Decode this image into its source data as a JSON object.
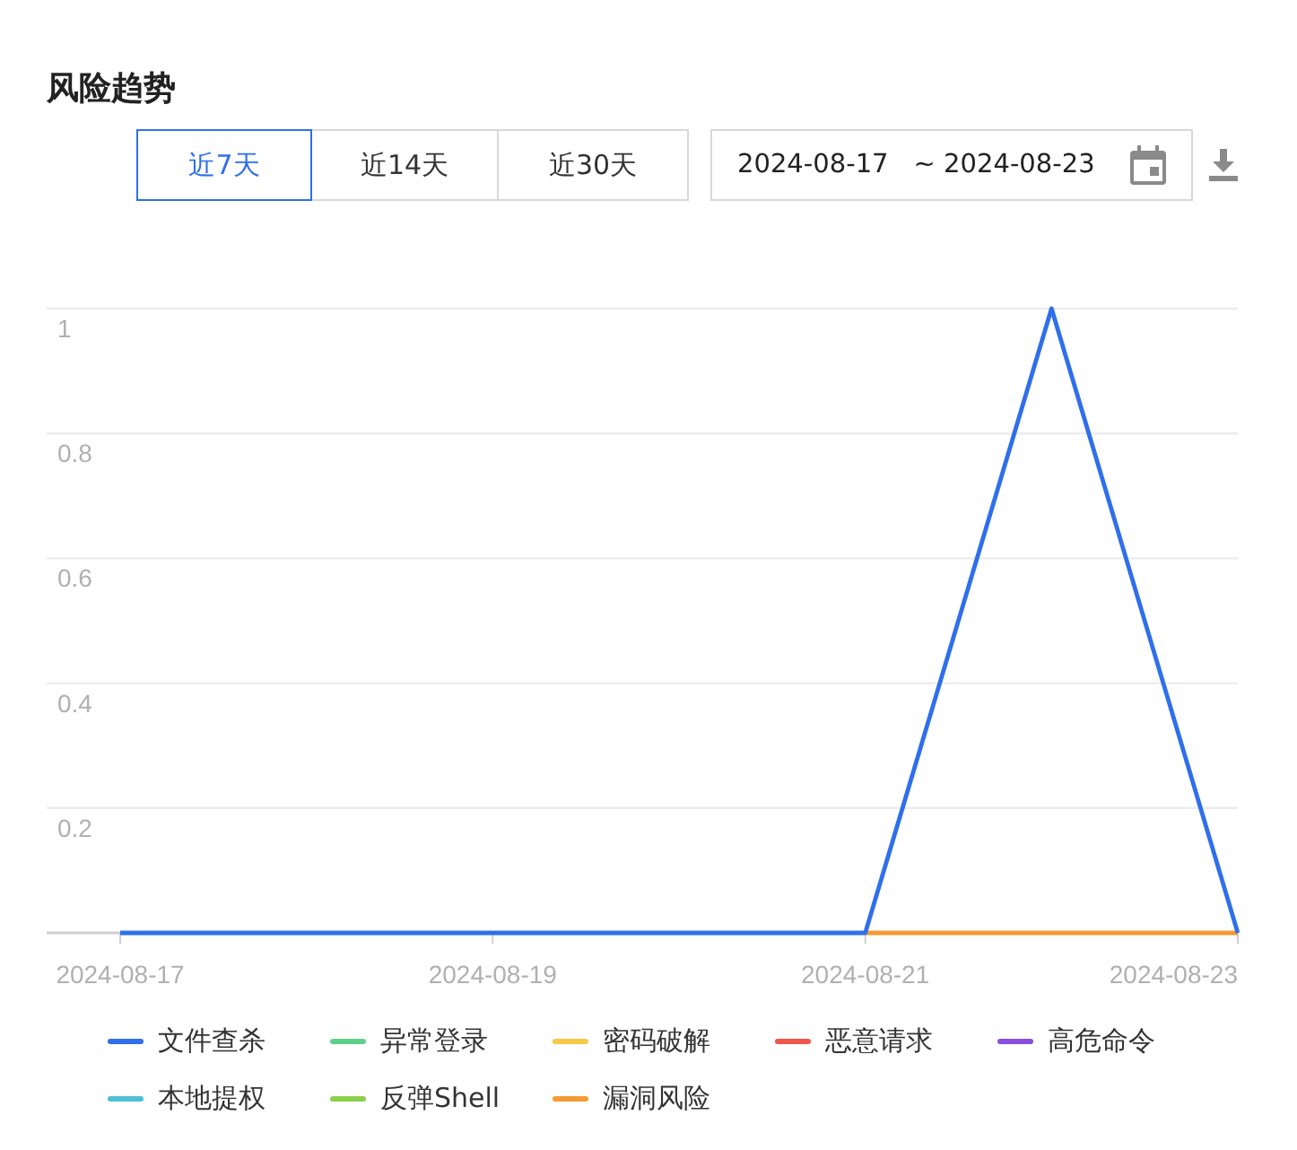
{
  "title": "风险趋势",
  "range_tabs": [
    {
      "label": "近7天",
      "selected": true
    },
    {
      "label": "近14天",
      "selected": false
    },
    {
      "label": "近30天",
      "selected": false
    }
  ],
  "date_range": {
    "start": "2024-08-17",
    "separator": "~",
    "end": "2024-08-23"
  },
  "chart_data": {
    "type": "line",
    "grid": true,
    "categories": [
      "2024-08-17",
      null,
      "2024-08-19",
      null,
      "2024-08-21",
      null,
      "2024-08-23"
    ],
    "ylim": [
      0,
      1
    ],
    "yticks": [
      {
        "value": 1,
        "label": "1"
      },
      {
        "value": 0.8,
        "label": "0.8"
      },
      {
        "value": 0.6,
        "label": "0.6"
      },
      {
        "value": 0.4,
        "label": "0.4"
      },
      {
        "value": 0.2,
        "label": "0.2"
      }
    ],
    "series": [
      {
        "name": "文件查杀",
        "color": "#2f6fea",
        "values": [
          0,
          0,
          0,
          0,
          0,
          1,
          0
        ]
      },
      {
        "name": "异常登录",
        "color": "#5fd08a",
        "values": [
          null,
          null,
          null,
          null,
          null,
          null,
          null
        ]
      },
      {
        "name": "密码破解",
        "color": "#f7c948",
        "values": [
          null,
          null,
          null,
          null,
          null,
          null,
          null
        ]
      },
      {
        "name": "恶意请求",
        "color": "#f0564a",
        "values": [
          null,
          null,
          null,
          null,
          null,
          null,
          null
        ]
      },
      {
        "name": "高危命令",
        "color": "#8a4fe0",
        "values": [
          null,
          null,
          null,
          null,
          null,
          null,
          null
        ]
      },
      {
        "name": "本地提权",
        "color": "#4ec0d4",
        "values": [
          null,
          null,
          null,
          null,
          null,
          null,
          null
        ]
      },
      {
        "name": "反弹Shell",
        "color": "#8bd04a",
        "values": [
          null,
          null,
          null,
          null,
          null,
          null,
          null
        ]
      },
      {
        "name": "漏洞风险",
        "color": "#f39a32",
        "values": [
          null,
          null,
          null,
          null,
          0,
          0,
          0
        ]
      }
    ]
  }
}
